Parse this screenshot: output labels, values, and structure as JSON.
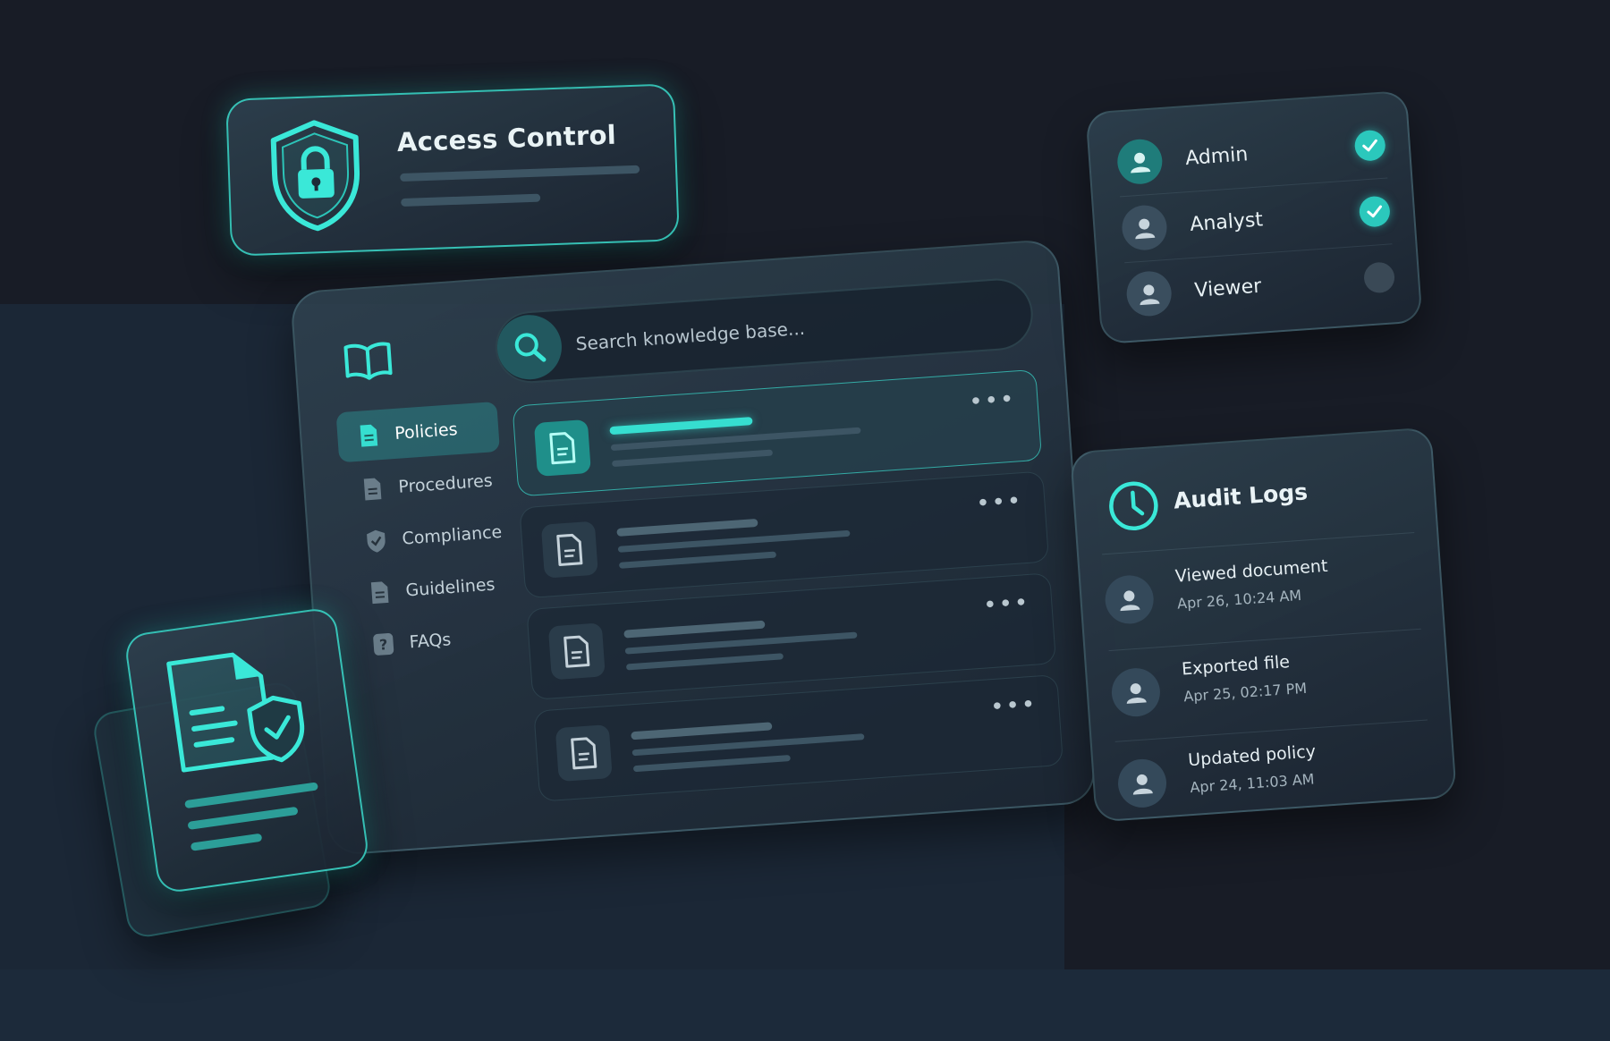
{
  "access_control": {
    "title": "Access Control",
    "icon": "shield-lock-icon"
  },
  "knowledge_base": {
    "logo_icon": "book-icon",
    "search": {
      "placeholder": "Search knowledge base..."
    },
    "nav": [
      {
        "label": "Policies",
        "icon": "document-icon",
        "active": true
      },
      {
        "label": "Procedures",
        "icon": "document-icon",
        "active": false
      },
      {
        "label": "Compliance",
        "icon": "shield-check-icon",
        "active": false
      },
      {
        "label": "Guidelines",
        "icon": "document-icon",
        "active": false
      },
      {
        "label": "FAQs",
        "icon": "question-icon",
        "active": false
      }
    ],
    "documents": [
      {
        "icon": "document-icon",
        "menu": "•••",
        "selected": true
      },
      {
        "icon": "document-icon",
        "menu": "•••",
        "selected": false
      },
      {
        "icon": "document-icon",
        "menu": "•••",
        "selected": false
      },
      {
        "icon": "document-icon",
        "menu": "•••",
        "selected": false
      }
    ]
  },
  "roles": [
    {
      "name": "Admin",
      "checked": true
    },
    {
      "name": "Analyst",
      "checked": true
    },
    {
      "name": "Viewer",
      "checked": false
    }
  ],
  "audit_logs": {
    "title": "Audit Logs",
    "icon": "clock-icon",
    "entries": [
      {
        "event": "Viewed document",
        "timestamp": "Apr 26, 10:24 AM"
      },
      {
        "event": "Exported file",
        "timestamp": "Apr 25, 02:17 PM"
      },
      {
        "event": "Updated policy",
        "timestamp": "Apr 24, 11:03 AM"
      }
    ]
  },
  "secure_document": {
    "icon": "secure-document-icon"
  },
  "colors": {
    "accent": "#36ded0",
    "background": "#181c26",
    "card": "#223140",
    "check": "#2bc8bc"
  }
}
